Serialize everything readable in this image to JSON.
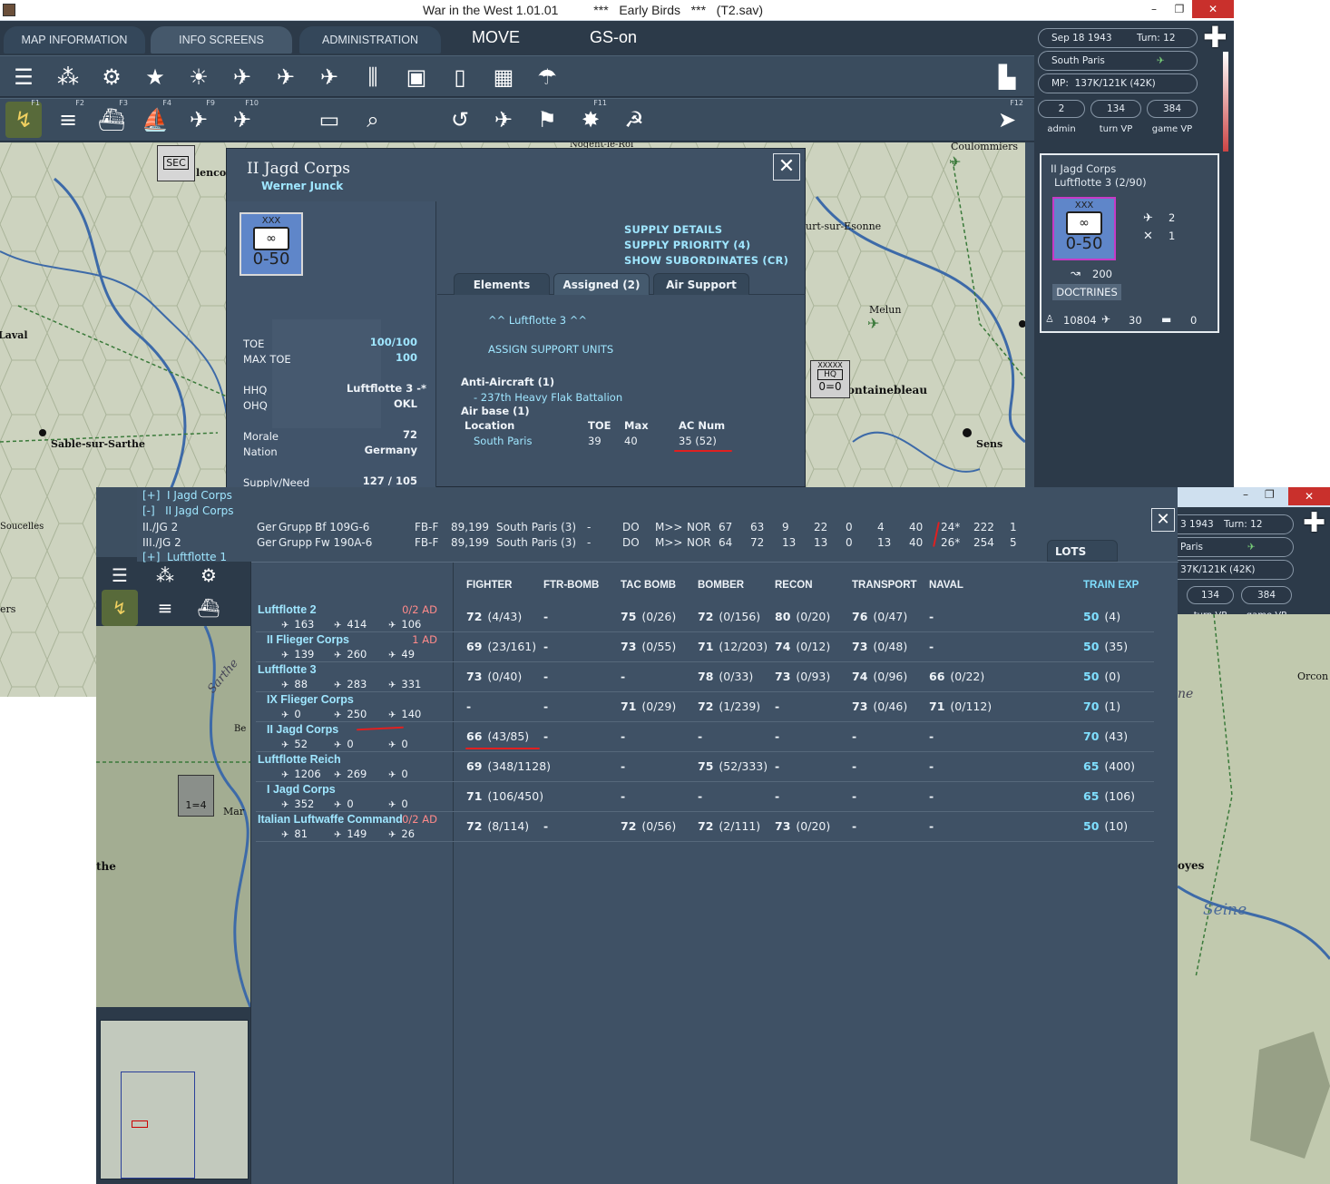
{
  "window": {
    "title": "War in the West 1.01.01          ***   Early Birds   ***   (T2.sav)",
    "min": "–",
    "max": "❐",
    "close": "✕"
  },
  "tabs": [
    "MAP INFORMATION",
    "INFO SCREENS",
    "ADMINISTRATION"
  ],
  "mode": {
    "move": "MOVE",
    "gs": "GS-on"
  },
  "fkeys": [
    "F1",
    "F2",
    "F3",
    "F4",
    "F9",
    "F10",
    "F11",
    "F12"
  ],
  "status": {
    "date": "Sep 18 1943",
    "turn": "Turn: 12",
    "location": "South Paris",
    "mp": "MP:  137K/121K (42K)",
    "admin": "2",
    "turn_vp": "134",
    "game_vp": "384",
    "admin_lbl": "admin",
    "turn_vp_lbl": "turn VP",
    "game_vp_lbl": "game VP"
  },
  "unit_card": {
    "name": "II Jagd Corps",
    "parent": "Luftflotte 3  (2/90)",
    "size": "XXX",
    "hq": "HQ",
    "value": "0-50",
    "planes": "2",
    "ac": "1",
    "mp": "200",
    "doctrines": "DOCTRINES",
    "men": "10804",
    "guns": "30",
    "tanks": "0"
  },
  "map_labels": {
    "coulommiers": "Coulommiers",
    "esonne": "urt-sur-Esonne",
    "melun": "Melun",
    "fontainebleau": "ontainebleau",
    "sens": "Sens",
    "laval": "Laval",
    "sable": "Sable-sur-Sarthe",
    "soucelles": "Soucelles",
    "sec": "SEC",
    "alenco": "lenco",
    "nogent": "Nogent-le-Roi",
    "fontainebleau_counter_size": "XXXXX",
    "fontainebleau_counter_type": "HQ",
    "fontainebleau_counter_value": "0=0",
    "sarthe": "Sarthe",
    "ers": "ers",
    "the": "the",
    "orcon": "Orcon",
    "oyes": "oyes",
    "seine": "Seine",
    "ne": "ne",
    "be": "Be",
    "mar": "Mar",
    "stack_value": "1=4"
  },
  "hq": {
    "title": "II Jagd Corps",
    "commander": "Werner Junck",
    "size": "XXX",
    "hq_label": "HQ",
    "value": "0-50",
    "toe_lbl": "TOE",
    "toe": "100/100",
    "maxtoe_lbl": "MAX TOE",
    "maxtoe": "100",
    "hhq_lbl": "HHQ",
    "hhq": "Luftflotte 3 -*",
    "ohq_lbl": "OHQ",
    "ohq": "OKL",
    "morale_lbl": "Morale",
    "morale": "72",
    "nation_lbl": "Nation",
    "nation": "Germany",
    "supply_lbl": "Supply/Need",
    "supply": "127 / 105",
    "links": [
      "SUPPLY DETAILS",
      "SUPPLY PRIORITY (4)",
      "SHOW SUBORDINATES (CR)"
    ],
    "tabs": [
      "Elements",
      "Assigned (2)",
      "Air Support"
    ],
    "airhq": "^^  Luftflotte 3  ^^",
    "assign": "ASSIGN SUPPORT UNITS",
    "aa_hdr": "Anti-Aircraft (1)",
    "aa_unit": "- 237th Heavy Flak Battalion",
    "ab_hdr": "Air base (1)",
    "cols": [
      "Location",
      "TOE",
      "Max",
      "AC Num"
    ],
    "base": {
      "loc": "South Paris",
      "toe": "39",
      "max": "40",
      "ac": "35 (52)"
    }
  },
  "w2": {
    "date": "3 1943",
    "turn": "Turn: 12",
    "loc": "Paris",
    "mp": "37K/121K (42K)",
    "turn_vp": "134",
    "game_vp": "384",
    "turn_vp_lbl": "turn VP",
    "game_vp_lbl": "game VP",
    "tab": "LOTS"
  },
  "tree": {
    "i_jagd": "[+]  I Jagd Corps",
    "ii_jagd": "[-]   II Jagd Corps",
    "lf1": "[+]  Luftflotte 1"
  },
  "groups": [
    {
      "name": "II./JG 2",
      "nat": "Ger",
      "type": "Grupp",
      "ac": "Bf 109G-6",
      "role": "FB-F",
      "mode": "89,199",
      "base": "South Paris (3)",
      "d": "-",
      "mis": "DO",
      "nav": "M>>",
      "targ": "NOR",
      "n1": "67",
      "n2": "63",
      "n3": "9",
      "n4": "22",
      "n5": "0",
      "n6": "4",
      "n7": "40",
      "n8": "24*",
      "n9": "222",
      "n10": "1"
    },
    {
      "name": "III./JG 2",
      "nat": "Ger",
      "type": "Grupp",
      "ac": "Fw 190A-6",
      "role": "FB-F",
      "mode": "89,199",
      "base": "South Paris (3)",
      "d": "-",
      "mis": "DO",
      "nav": "M>>",
      "targ": "NOR",
      "n1": "64",
      "n2": "72",
      "n3": "13",
      "n4": "13",
      "n5": "0",
      "n6": "13",
      "n7": "40",
      "n8": "26*",
      "n9": "254",
      "n10": "5"
    }
  ],
  "table_headers": [
    "FIGHTER",
    "FTR-BOMB",
    "TAC BOMB",
    "BOMBER",
    "RECON",
    "TRANSPORT",
    "NAVAL",
    "TRAIN EXP"
  ],
  "rows": [
    {
      "name": "Luftflotte 2",
      "ind": false,
      "ad": "0/2 AD",
      "c1": "163",
      "c2": "414",
      "c3": "106",
      "cells": [
        [
          "72",
          "(4/43)"
        ],
        [
          "-",
          ""
        ],
        [
          "75",
          "(0/26)"
        ],
        [
          "72",
          "(0/156)"
        ],
        [
          "80",
          "(0/20)"
        ],
        [
          "76",
          "(0/47)"
        ],
        [
          "-",
          ""
        ],
        [
          "50",
          "(4)"
        ]
      ]
    },
    {
      "name": "II Flieger Corps",
      "ind": true,
      "ad": "1 AD",
      "c1": "139",
      "c2": "260",
      "c3": "49",
      "cells": [
        [
          "69",
          "(23/161)"
        ],
        [
          "-",
          ""
        ],
        [
          "73",
          "(0/55)"
        ],
        [
          "71",
          "(12/203)"
        ],
        [
          "74",
          "(0/12)"
        ],
        [
          "73",
          "(0/48)"
        ],
        [
          "-",
          ""
        ],
        [
          "50",
          "(35)"
        ]
      ]
    },
    {
      "name": "Luftflotte 3",
      "ind": false,
      "ad": "",
      "c1": "88",
      "c2": "283",
      "c3": "331",
      "cells": [
        [
          "73",
          "(0/40)"
        ],
        [
          "-",
          ""
        ],
        [
          "-",
          ""
        ],
        [
          "78",
          "(0/33)"
        ],
        [
          "73",
          "(0/93)"
        ],
        [
          "74",
          "(0/96)"
        ],
        [
          "66",
          "(0/22)"
        ],
        [
          "50",
          "(0)"
        ]
      ]
    },
    {
      "name": "IX Flieger Corps",
      "ind": true,
      "ad": "",
      "c1": "0",
      "c2": "250",
      "c3": "140",
      "cells": [
        [
          "-",
          ""
        ],
        [
          "-",
          ""
        ],
        [
          "71",
          "(0/29)"
        ],
        [
          "72",
          "(1/239)"
        ],
        [
          "-",
          ""
        ],
        [
          "73",
          "(0/46)"
        ],
        [
          "71",
          "(0/112)"
        ],
        [
          "70",
          "(1)"
        ]
      ]
    },
    {
      "name": "II Jagd Corps",
      "ind": true,
      "ad": "",
      "c1": "52",
      "c2": "0",
      "c3": "0",
      "cells": [
        [
          "66",
          "(43/85)"
        ],
        [
          "-",
          ""
        ],
        [
          "-",
          ""
        ],
        [
          "-",
          ""
        ],
        [
          "-",
          ""
        ],
        [
          "-",
          ""
        ],
        [
          "-",
          ""
        ],
        [
          "70",
          "(43)"
        ]
      ]
    },
    {
      "name": "Luftflotte Reich",
      "ind": false,
      "ad": "",
      "c1": "1206",
      "c2": "269",
      "c3": "0",
      "cells": [
        [
          "69",
          "(348/1128)"
        ],
        [
          "",
          ""
        ],
        [
          "-",
          ""
        ],
        [
          "75",
          "(52/333)"
        ],
        [
          "-",
          ""
        ],
        [
          "-",
          ""
        ],
        [
          "-",
          ""
        ],
        [
          "65",
          "(400)"
        ]
      ]
    },
    {
      "name": "I Jagd Corps",
      "ind": true,
      "ad": "",
      "c1": "352",
      "c2": "0",
      "c3": "0",
      "cells": [
        [
          "71",
          "(106/450)"
        ],
        [
          "",
          ""
        ],
        [
          "-",
          ""
        ],
        [
          "-",
          ""
        ],
        [
          "-",
          ""
        ],
        [
          "-",
          ""
        ],
        [
          "-",
          ""
        ],
        [
          "65",
          "(106)"
        ]
      ]
    },
    {
      "name": "Italian Luftwaffe Command",
      "ind": false,
      "ad": "0/2 AD",
      "c1": "81",
      "c2": "149",
      "c3": "26",
      "cells": [
        [
          "72",
          "(8/114)"
        ],
        [
          "-",
          ""
        ],
        [
          "72",
          "(0/56)"
        ],
        [
          "72",
          "(2/111)"
        ],
        [
          "73",
          "(0/20)"
        ],
        [
          "-",
          ""
        ],
        [
          "-",
          ""
        ],
        [
          "50",
          "(10)"
        ]
      ]
    }
  ],
  "colors": {
    "accent_cyan": "#9fe6ff",
    "ad_red": "#ff8a8a",
    "annotation_red": "#e02020",
    "panel": "#3f5165"
  }
}
